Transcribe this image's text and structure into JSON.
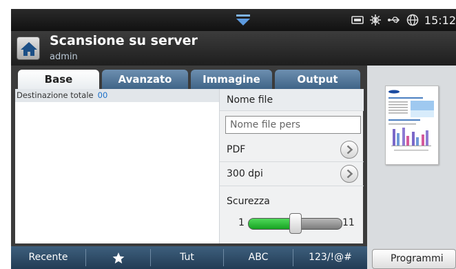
{
  "status_bar": {
    "time": "15:12",
    "icons": [
      "pulldown-arrow-icon",
      "keyboard-icon",
      "toner-saver-icon",
      "usb-icon",
      "network-globe-icon"
    ]
  },
  "header": {
    "title": "Scansione su server",
    "subtitle": "admin",
    "home_icon": "home-icon"
  },
  "tabs": [
    {
      "label": "Base",
      "active": true
    },
    {
      "label": "Avanzato",
      "active": false
    },
    {
      "label": "Immagine",
      "active": false
    },
    {
      "label": "Output",
      "active": false
    }
  ],
  "destination": {
    "label": "Destinazione totale",
    "count": "00"
  },
  "settings": {
    "file_name_label": "Nome file",
    "file_name_placeholder": "Nome file pers",
    "file_format": "PDF",
    "resolution": "300 dpi",
    "darkness_label": "Scurezza",
    "darkness_min": "1",
    "darkness_max": "11",
    "darkness_value_fraction": 0.5
  },
  "bottom_bar": {
    "recent": "Recente",
    "favorites_icon": "star-icon",
    "all": "Tut",
    "abc": "ABC",
    "symbols": "123/!@#"
  },
  "programs_button": "Programmi",
  "colors": {
    "accent_blue": "#3f6487",
    "slider_green": "#17a322",
    "count_blue": "#1a6fc9"
  }
}
